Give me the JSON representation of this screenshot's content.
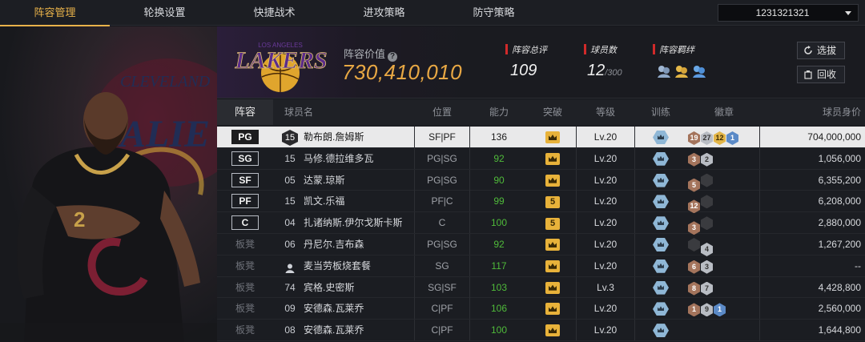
{
  "nav": {
    "tabs": [
      "阵容管理",
      "轮换设置",
      "快捷战术",
      "进攻策略",
      "防守策略"
    ],
    "active_index": 0,
    "account": "1231321321"
  },
  "team": {
    "logo_text": "LAKERS",
    "logo_small_text": "LOS ANGELES",
    "value_label": "阵容价值",
    "value": "730,410,010",
    "overall_label": "阵容总评",
    "overall": "109",
    "count_label": "球员数",
    "count": "12",
    "count_max": "/300",
    "chem_label": "阵容羁绊",
    "select_label": "选拔",
    "recycle_label": "回收"
  },
  "table": {
    "headers": {
      "lineup": "阵容",
      "name": "球员名",
      "position": "位置",
      "ability": "能力",
      "breakthrough": "突破",
      "level": "等级",
      "training": "训练",
      "badges": "徽章",
      "value": "球员身价"
    },
    "rows": [
      {
        "slot": "PG",
        "starter": true,
        "selected": true,
        "number": "15",
        "hex_number": true,
        "name": "勒布朗.詹姆斯",
        "position": "SF|PF",
        "ability": "136",
        "ability_green": false,
        "breakthrough": "crown",
        "level": "Lv.20",
        "badges": [
          {
            "t": "br",
            "v": "19"
          },
          {
            "t": "sv",
            "v": "27"
          },
          {
            "t": "gd",
            "v": "12"
          },
          {
            "t": "hf",
            "v": "1"
          }
        ],
        "value": "704,000,000"
      },
      {
        "slot": "SG",
        "starter": true,
        "number": "15",
        "name": "马修.德拉维多瓦",
        "position": "PG|SG",
        "ability": "92",
        "ability_green": true,
        "breakthrough": "crown",
        "level": "Lv.20",
        "badges": [
          {
            "t": "br",
            "v": "3"
          },
          {
            "t": "sv",
            "v": "2"
          }
        ],
        "value": "1,056,000"
      },
      {
        "slot": "SF",
        "starter": true,
        "number": "05",
        "name": "达蒙.琼斯",
        "position": "PG|SG",
        "ability": "90",
        "ability_green": true,
        "breakthrough": "crown",
        "level": "Lv.20",
        "badges": [
          {
            "t": "br",
            "v": "5"
          },
          {
            "t": "dk",
            "v": ""
          }
        ],
        "value": "6,355,200"
      },
      {
        "slot": "PF",
        "starter": true,
        "number": "15",
        "name": "凯文.乐福",
        "position": "PF|C",
        "ability": "99",
        "ability_green": true,
        "breakthrough": "5",
        "level": "Lv.20",
        "badges": [
          {
            "t": "br",
            "v": "12"
          },
          {
            "t": "dk",
            "v": ""
          }
        ],
        "value": "6,208,000"
      },
      {
        "slot": "C",
        "starter": true,
        "number": "04",
        "name": "扎诸纳斯.伊尔戈斯卡斯",
        "position": "C",
        "ability": "100",
        "ability_green": true,
        "breakthrough": "5",
        "level": "Lv.20",
        "badges": [
          {
            "t": "br",
            "v": "3"
          },
          {
            "t": "dk",
            "v": ""
          }
        ],
        "value": "2,880,000"
      },
      {
        "slot": "板凳",
        "starter": false,
        "number": "06",
        "name": "丹尼尔.吉布森",
        "position": "PG|SG",
        "ability": "92",
        "ability_green": true,
        "breakthrough": "crown",
        "level": "Lv.20",
        "badges": [
          {
            "t": "dk",
            "v": ""
          },
          {
            "t": "sv",
            "v": "4"
          }
        ],
        "value": "1,267,200"
      },
      {
        "slot": "板凳",
        "starter": false,
        "number": "",
        "person_icon": true,
        "name": "麦当劳板烧套餐",
        "position": "SG",
        "ability": "117",
        "ability_green": true,
        "breakthrough": "crown",
        "level": "Lv.20",
        "badges": [
          {
            "t": "br",
            "v": "6"
          },
          {
            "t": "sv",
            "v": "3"
          }
        ],
        "value": "--"
      },
      {
        "slot": "板凳",
        "starter": false,
        "number": "74",
        "name": "宾格.史密斯",
        "position": "SG|SF",
        "ability": "103",
        "ability_green": true,
        "breakthrough": "crown",
        "level": "Lv.3",
        "badges": [
          {
            "t": "br",
            "v": "8"
          },
          {
            "t": "sv",
            "v": "7"
          }
        ],
        "value": "4,428,800"
      },
      {
        "slot": "板凳",
        "starter": false,
        "number": "09",
        "name": "安德森.瓦莱乔",
        "position": "C|PF",
        "ability": "106",
        "ability_green": true,
        "breakthrough": "crown",
        "level": "Lv.20",
        "badges": [
          {
            "t": "br",
            "v": "1"
          },
          {
            "t": "sv",
            "v": "9"
          },
          {
            "t": "hf",
            "v": "1"
          }
        ],
        "value": "2,560,000"
      },
      {
        "slot": "板凳",
        "starter": false,
        "number": "08",
        "name": "安德森.瓦莱乔",
        "position": "C|PF",
        "ability": "100",
        "ability_green": true,
        "breakthrough": "crown",
        "level": "Lv.20",
        "badges": [],
        "value": "1,644,800"
      }
    ]
  },
  "colors": {
    "accent": "#e8b24a",
    "value_gold": "#e8a844",
    "ability_green": "#4fba3a",
    "selected_row": "#e9e9ea",
    "label_red": "#d12a2a"
  }
}
